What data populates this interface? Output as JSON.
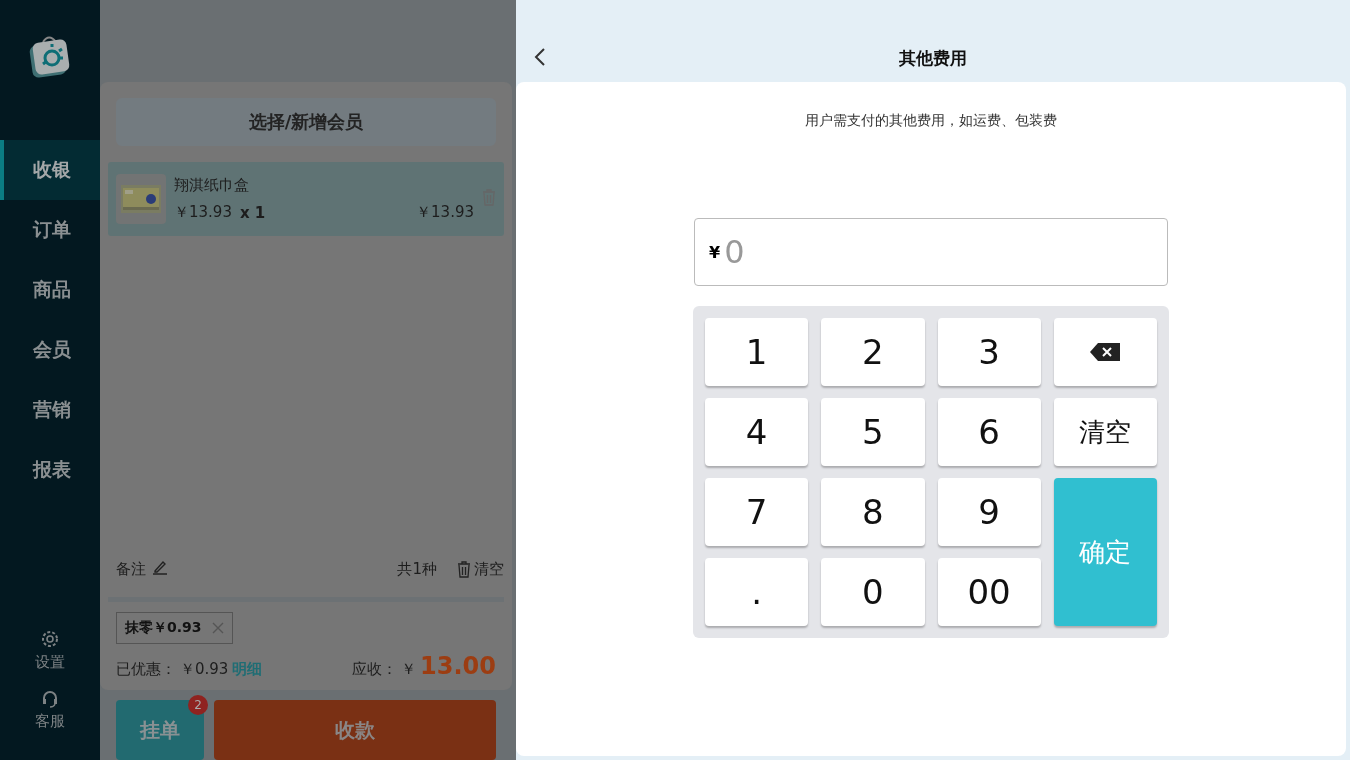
{
  "sidebar": {
    "items": [
      {
        "label": "收银",
        "selected": true
      },
      {
        "label": "订单",
        "selected": false
      },
      {
        "label": "商品",
        "selected": false
      },
      {
        "label": "会员",
        "selected": false
      },
      {
        "label": "营销",
        "selected": false
      },
      {
        "label": "报表",
        "selected": false
      }
    ],
    "bottom": [
      {
        "kind": "settings",
        "label": "设置"
      },
      {
        "kind": "support",
        "label": "客服"
      }
    ]
  },
  "cart": {
    "member_button": "选择/新增会员",
    "items": [
      {
        "name": "翔淇纸巾盒",
        "price": "￥13.93",
        "qty": "x 1",
        "total": "￥13.93"
      }
    ],
    "note": "备注",
    "count": "共1种",
    "clear": "清空",
    "discount_chip": "抹零￥0.93",
    "discount_label": "已优惠：",
    "discount_value": "￥0.93",
    "details_link": "明细",
    "due_label": "应收：",
    "due_currency": "￥",
    "due_value": "13.00",
    "hold_button": "挂单",
    "hold_badge": "2",
    "pay_button": "收款"
  },
  "fee_panel": {
    "title": "其他费用",
    "subtitle": "用户需支付的其他费用，如运费、包装费",
    "amount_field": {
      "prefix": "¥",
      "placeholder": "0"
    },
    "keys": [
      {
        "kind": "digit",
        "label": "1"
      },
      {
        "kind": "digit",
        "label": "2"
      },
      {
        "kind": "digit",
        "label": "3"
      },
      {
        "kind": "backspace"
      },
      {
        "kind": "digit",
        "label": "4"
      },
      {
        "kind": "digit",
        "label": "5"
      },
      {
        "kind": "digit",
        "label": "6"
      },
      {
        "kind": "clear",
        "label": "清空"
      },
      {
        "kind": "digit",
        "label": "7"
      },
      {
        "kind": "digit",
        "label": "8"
      },
      {
        "kind": "digit",
        "label": "9"
      },
      {
        "kind": "confirm",
        "label": "确定"
      },
      {
        "kind": "digit",
        "label": "."
      },
      {
        "kind": "digit",
        "label": "0"
      },
      {
        "kind": "digit",
        "label": "00"
      }
    ]
  }
}
